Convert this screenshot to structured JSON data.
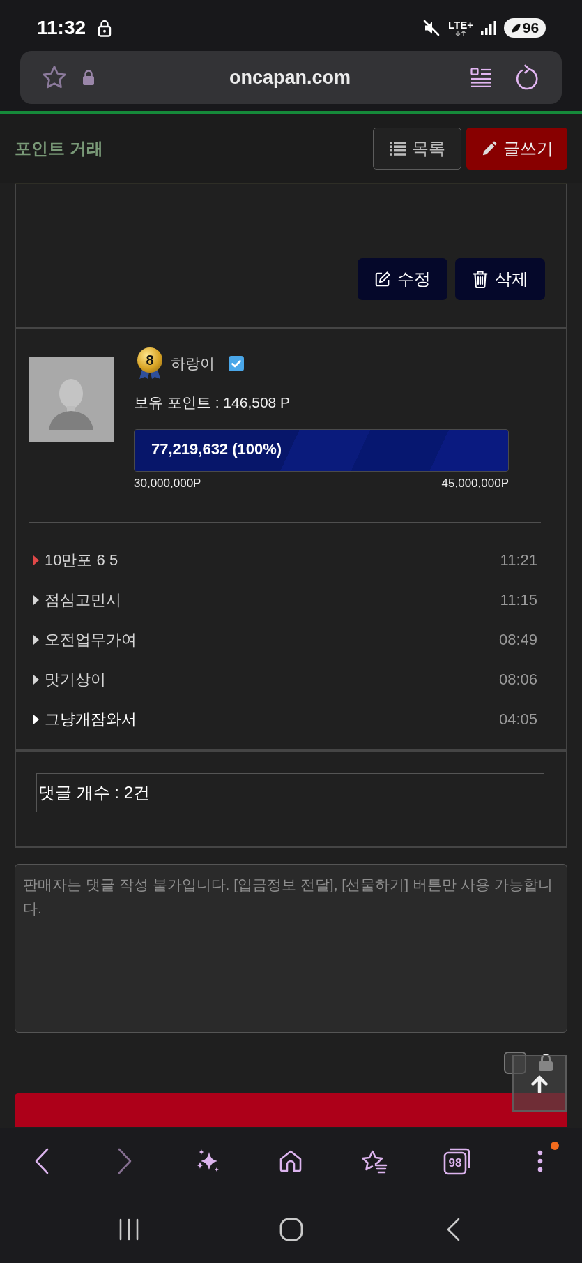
{
  "status_bar": {
    "time": "11:32",
    "network": "LTE+",
    "battery": "96"
  },
  "browser": {
    "url": "oncapan.com",
    "tab_count": "98",
    "forward_disabled": true,
    "menu_badge": true
  },
  "header": {
    "title": "포인트 거래",
    "buttons": [
      {
        "kind": "list",
        "label": "목록"
      },
      {
        "kind": "write",
        "label": "글쓰기"
      }
    ]
  },
  "post_actions": [
    {
      "kind": "edit",
      "label": "수정"
    },
    {
      "kind": "delete",
      "label": "삭제"
    }
  ],
  "author": {
    "rank": "8",
    "name": "하랑이",
    "verified": true,
    "points": "보유 포인트 : 146,508 P",
    "progress": {
      "label": "77,219,632 (100%)",
      "level": 1,
      "min_label": "30,000,000P",
      "max_label": "45,000,000P"
    }
  },
  "recent_posts": [
    {
      "title": "10만포 6 5",
      "time": "11:21",
      "selected": true,
      "visited": true
    },
    {
      "title": "점심고민시",
      "time": "11:15",
      "selected": false,
      "visited": true
    },
    {
      "title": "오전업무가여",
      "time": "08:49",
      "selected": false,
      "visited": true
    },
    {
      "title": "맛기상이",
      "time": "08:06",
      "selected": false,
      "visited": true
    },
    {
      "title": "그냥개잠와서",
      "time": "04:05",
      "selected": false,
      "visited": false
    }
  ],
  "comment_count": "댓글 개수 : 2건",
  "comment_form": {
    "placeholder": "판매자는 댓글 작성 불가입니다. [입금정보 전달], [선물하기] 버튼만 사용 가능합니다.",
    "secret": false
  }
}
